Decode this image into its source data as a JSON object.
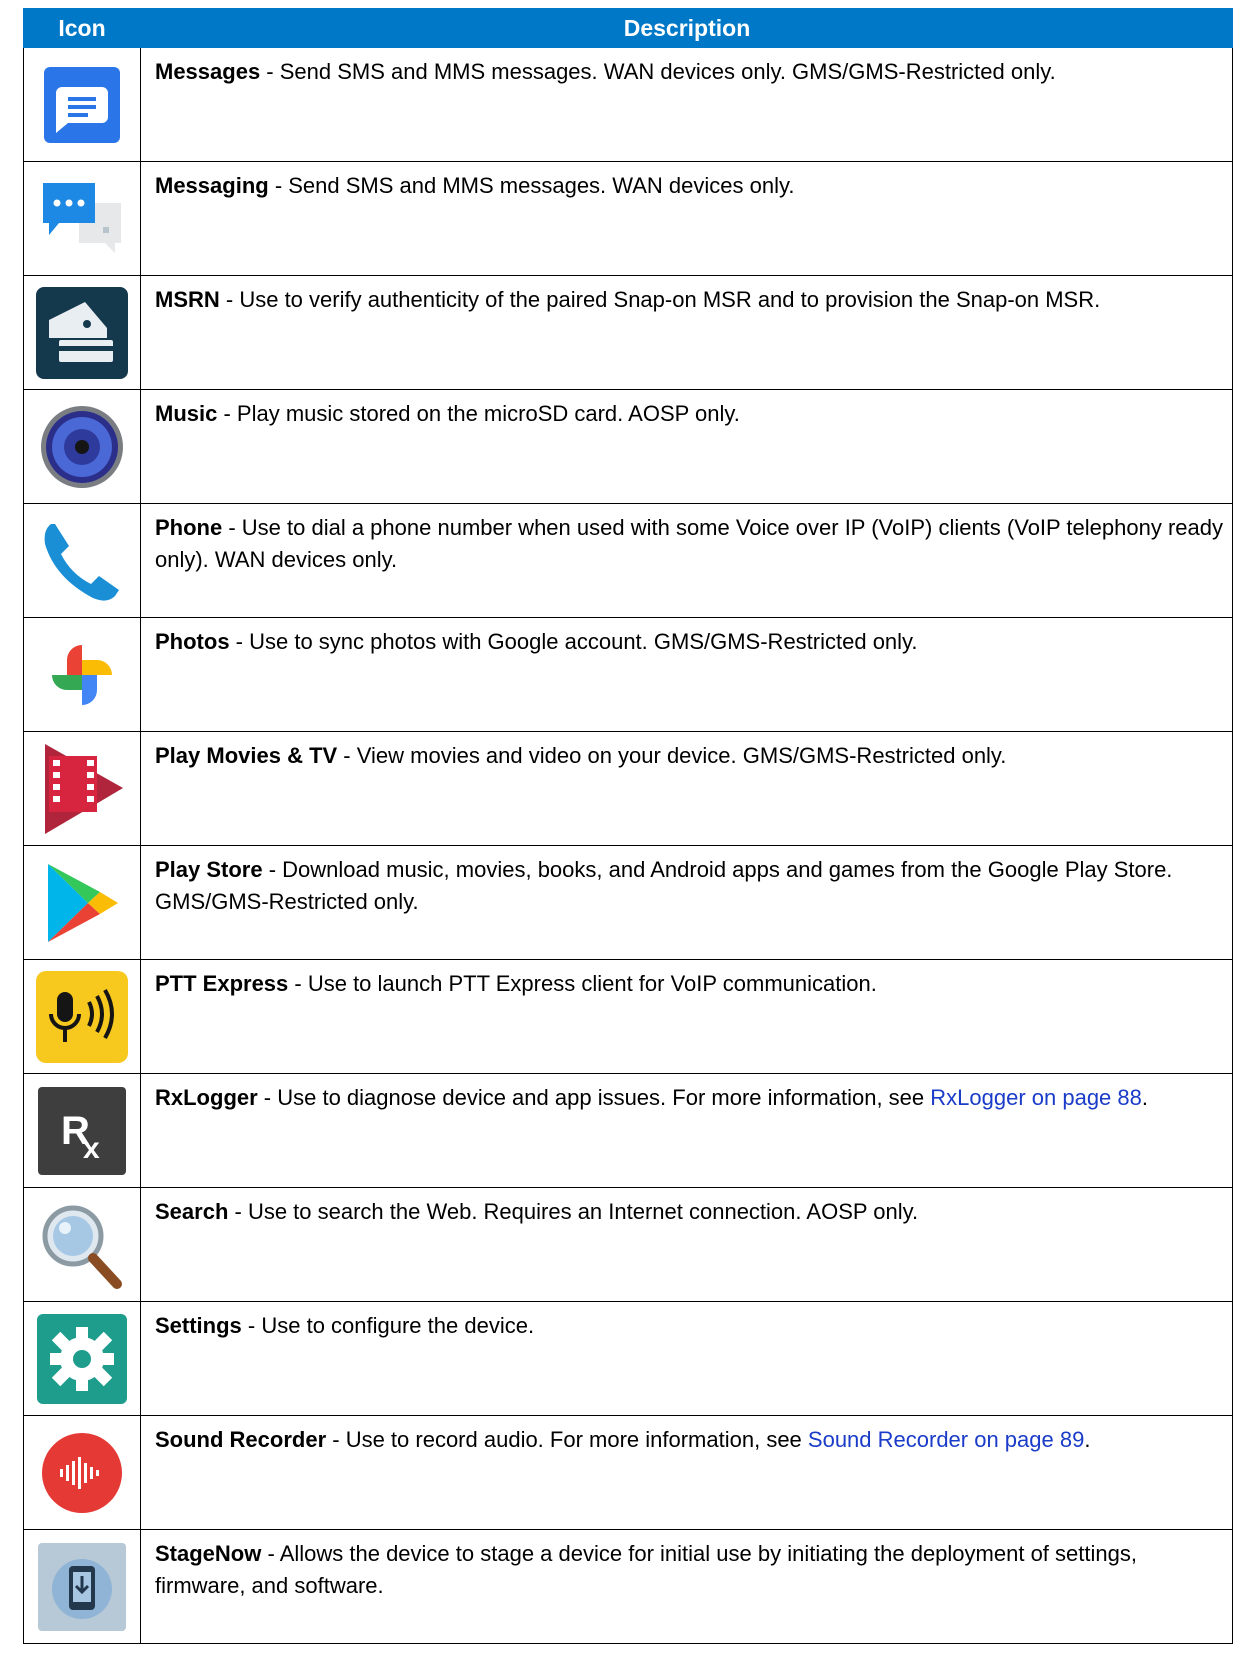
{
  "table": {
    "headers": {
      "icon": "Icon",
      "description": "Description"
    },
    "rows": [
      {
        "icon": "messages-icon",
        "name": "Messages",
        "text": " - Send SMS and MMS messages. WAN devices only. GMS/GMS-Restricted only."
      },
      {
        "icon": "messaging-icon",
        "name": "Messaging",
        "text": " - Send SMS and MMS messages. WAN devices only."
      },
      {
        "icon": "msrn-icon",
        "name": "MSRN",
        "text": " - Use to verify authenticity of the paired Snap-on MSR and to provision the Snap-on MSR."
      },
      {
        "icon": "music-speaker-icon",
        "name": "Music",
        "text": " - Play music stored on the microSD card. AOSP only."
      },
      {
        "icon": "phone-icon",
        "name": "Phone",
        "text": " - Use to dial a phone number when used with some Voice over IP (VoIP) clients (VoIP telephony ready only). WAN devices only."
      },
      {
        "icon": "photos-pinwheel-icon",
        "name": "Photos",
        "text": " - Use to sync photos with Google account. GMS/GMS-Restricted only."
      },
      {
        "icon": "play-movies-icon",
        "name": "Play Movies & TV",
        "text": " - View movies and video on your device. GMS/GMS-Restricted only."
      },
      {
        "icon": "play-store-icon",
        "name": "Play Store",
        "text": " - Download music, movies, books, and Android apps and games from the Google Play Store. GMS/GMS-Restricted only."
      },
      {
        "icon": "ptt-microphone-icon",
        "name": "PTT Express",
        "text": " - Use to launch PTT Express client for VoIP communication."
      },
      {
        "icon": "rx-logger-icon",
        "name": "RxLogger",
        "text": " - Use to diagnose device and app issues. For more information, see ",
        "link": "RxLogger on page 88",
        "after": "."
      },
      {
        "icon": "magnifier-icon",
        "name": "Search",
        "text": " - Use to search the Web. Requires an Internet connection. AOSP only."
      },
      {
        "icon": "settings-gear-icon",
        "name": "Settings",
        "text": " - Use to configure the device."
      },
      {
        "icon": "sound-recorder-icon",
        "name": "Sound Recorder",
        "text": " - Use to record audio. For more information, see ",
        "link": "Sound Recorder on page 89",
        "after": "."
      },
      {
        "icon": "stagenow-icon",
        "name": "StageNow",
        "text": " - Allows the device to stage a device for initial use by initiating the deployment of settings, firmware, and software."
      }
    ]
  }
}
